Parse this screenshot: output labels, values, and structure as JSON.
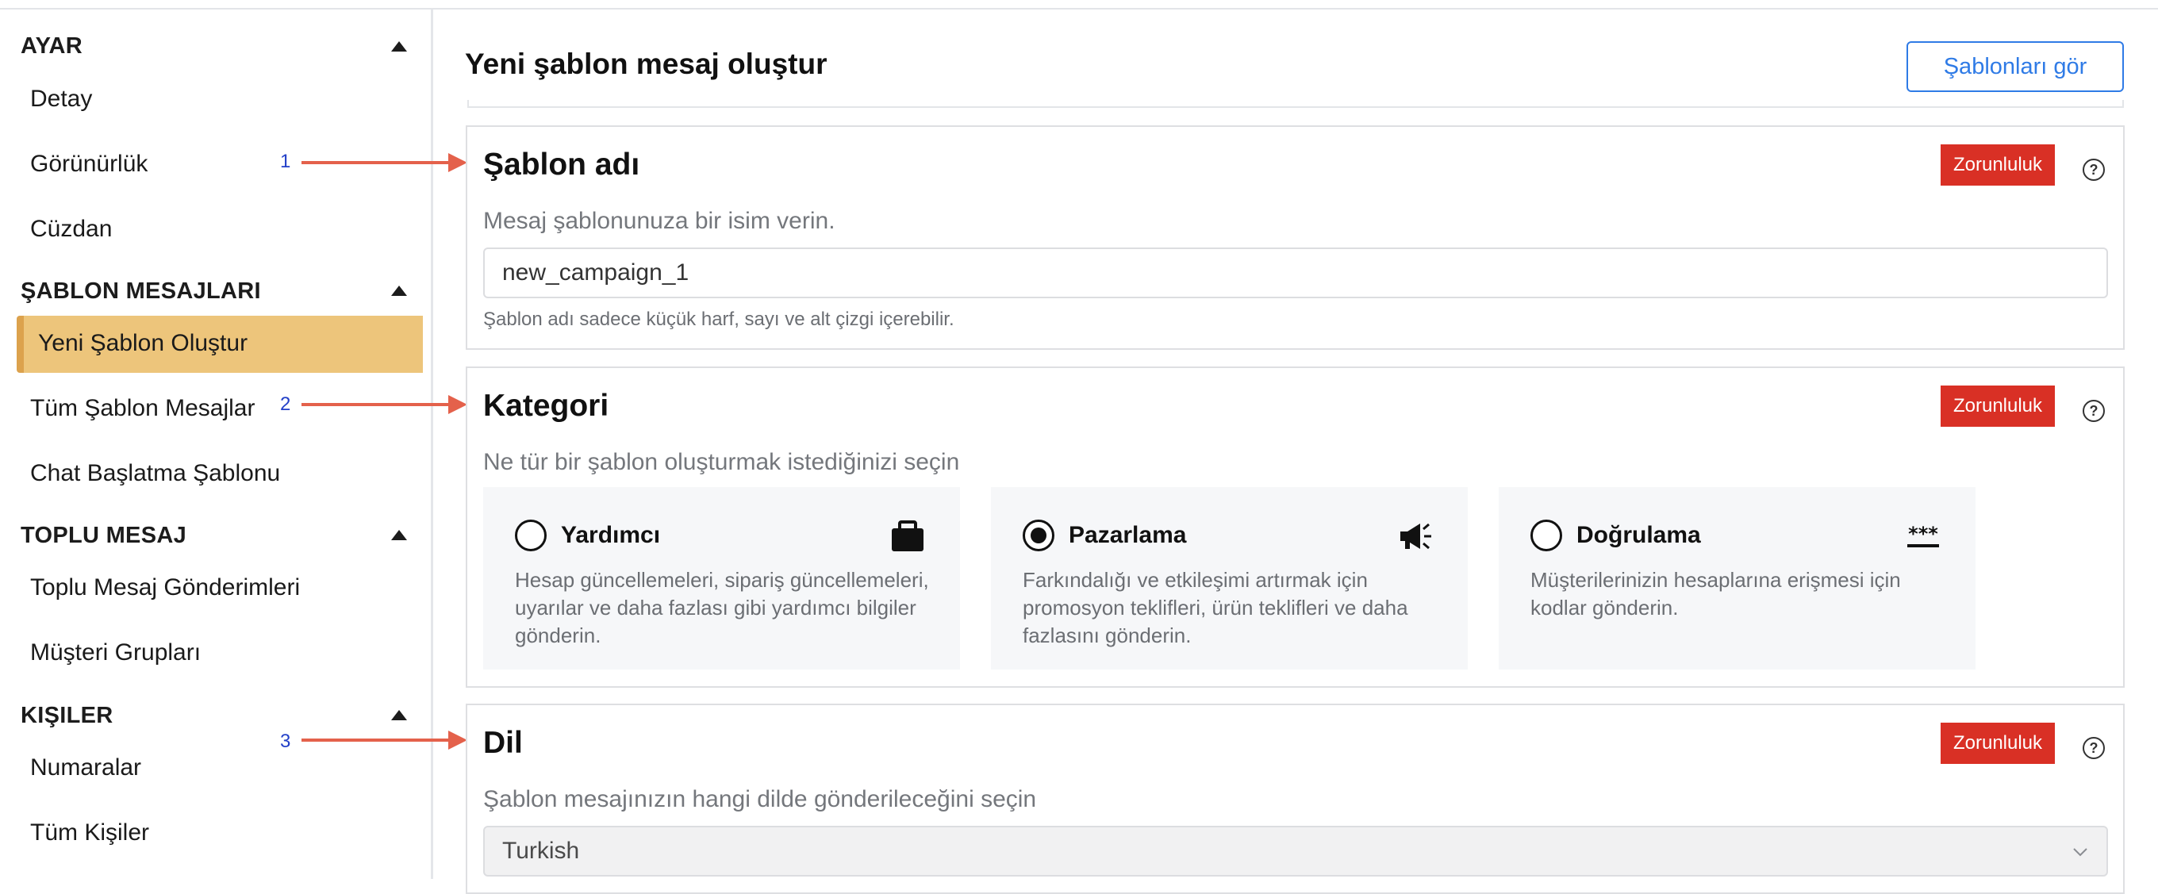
{
  "sidebar": {
    "sections": [
      {
        "title": "AYAR",
        "items": [
          "Detay",
          "Görünürlük",
          "Cüzdan"
        ]
      },
      {
        "title": "ŞABLON MESAJLARI",
        "items": [
          "Yeni Şablon Oluştur",
          "Tüm Şablon Mesajlar",
          "Chat Başlatma Şablonu"
        ]
      },
      {
        "title": "TOPLU MESAJ",
        "items": [
          "Toplu Mesaj Gönderimleri",
          "Müşteri Grupları"
        ]
      },
      {
        "title": "KIŞILER",
        "items": [
          "Numaralar",
          "Tüm Kişiler"
        ]
      }
    ],
    "active_item": "Yeni Şablon Oluştur"
  },
  "annotations": [
    "1",
    "2",
    "3"
  ],
  "header": {
    "title": "Yeni şablon mesaj oluştur",
    "view_templates_label": "Şablonları gör"
  },
  "template_name": {
    "title": "Şablon adı",
    "required_label": "Zorunluluk",
    "description": "Mesaj şablonunuza bir isim verin.",
    "value": "new_campaign_1",
    "hint": "Şablon adı sadece küçük harf, sayı ve alt çizgi içerebilir."
  },
  "category": {
    "title": "Kategori",
    "required_label": "Zorunluluk",
    "description": "Ne tür bir şablon oluşturmak istediğinizi seçin",
    "options": [
      {
        "title": "Yardımcı",
        "description": "Hesap güncellemeleri, sipariş güncellemeleri, uyarılar ve daha fazlası gibi yardımcı bilgiler gönderin.",
        "icon": "briefcase-icon",
        "selected": false
      },
      {
        "title": "Pazarlama",
        "description": "Farkındalığı ve etkileşimi artırmak için promosyon teklifleri, ürün teklifleri ve daha fazlasını gönderin.",
        "icon": "megaphone-icon",
        "selected": true
      },
      {
        "title": "Doğrulama",
        "description": "Müşterilerinizin hesaplarına erişmesi için kodlar gönderin.",
        "icon": "password-icon",
        "selected": false
      }
    ]
  },
  "language": {
    "title": "Dil",
    "required_label": "Zorunluluk",
    "description": "Şablon mesajınızın hangi dilde gönderileceğini seçin",
    "selected": "Turkish"
  },
  "colors": {
    "active_bg": "#edc57b",
    "active_border": "#dca24d",
    "badge_red": "#d93025",
    "accent_blue": "#2f7be6",
    "annotation_arrow": "#e4614b",
    "annotation_number": "#2340c8"
  }
}
